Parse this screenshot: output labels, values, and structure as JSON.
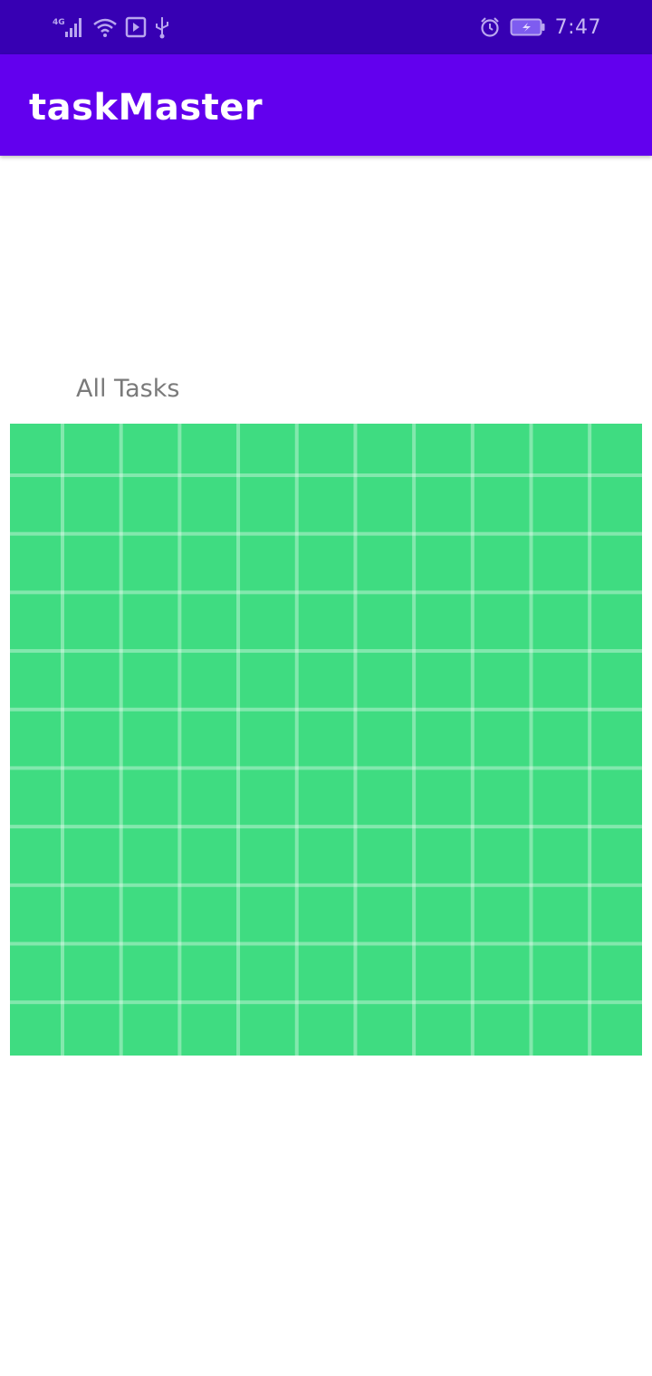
{
  "status_bar": {
    "network_type": "4G",
    "time": "7:47",
    "icons": [
      "signal-icon",
      "wifi-icon",
      "screen-cast-icon",
      "usb-icon",
      "alarm-icon",
      "battery-charging-icon"
    ]
  },
  "app_bar": {
    "title": "taskMaster"
  },
  "main": {
    "section_label": "All Tasks",
    "image_color": "#3fdc81"
  },
  "colors": {
    "status_bar": "#3700b3",
    "app_bar": "#6200ee",
    "label_text": "#7a7a7a"
  }
}
